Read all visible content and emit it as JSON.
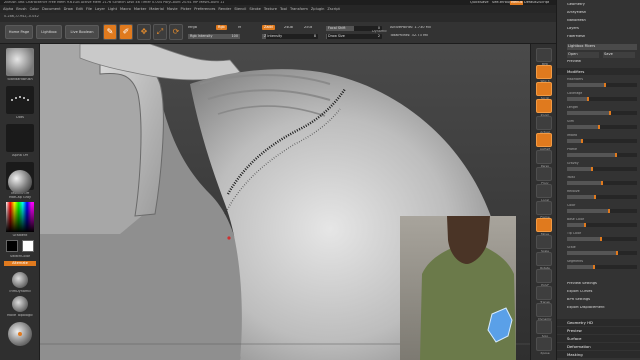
{
  "titlebar": {
    "app": "ZBrush 4R8 P2",
    "items": [
      "ZBrush 4R8",
      "Character09",
      "Free Mem 9.61GB",
      "Active Mem 2176",
      "Scratch Disk 46",
      "Timer 0.004",
      "PolyCount 20.61 MP",
      "MeshCount 11"
    ],
    "quicksave": "QuickSave",
    "seethrough": "See-through 0",
    "menus_btn": "Menus",
    "defaultscript": "DefaultZScript"
  },
  "menubar": [
    "Alpha",
    "Brush",
    "Color",
    "Document",
    "Draw",
    "Edit",
    "File",
    "Layer",
    "Light",
    "Macro",
    "Marker",
    "Material",
    "Movie",
    "Picker",
    "Preferences",
    "Render",
    "Stencil",
    "Stroke",
    "Texture",
    "Tool",
    "Transform",
    "Zplugin",
    "Zscript"
  ],
  "statline": "0.286,-0.942,-0.042",
  "toolbar": {
    "home": "Home Page",
    "lightbox": "Lightbox",
    "livebool": "Live Boolean",
    "icons": [
      {
        "name": "edit-icon",
        "glyph": "✎",
        "label": "Edit"
      },
      {
        "name": "draw-icon",
        "glyph": "✐",
        "label": "Draw"
      },
      {
        "name": "move-icon",
        "glyph": "✥",
        "label": "Move"
      },
      {
        "name": "scale-icon",
        "glyph": "⤢",
        "label": "Scale"
      },
      {
        "name": "rotate-icon",
        "glyph": "⟳",
        "label": "Rotate"
      }
    ],
    "mrgb": "Mrgb",
    "rgb": "Rgb",
    "m": "M",
    "zadd": "Zadd",
    "zsub": "Zsub",
    "zcut": "Zcut",
    "rgb_intensity_label": "Rgb Intensity",
    "rgb_intensity": "100",
    "rgb_intensity_pct": 1.0,
    "z_intensity_label": "Z Intensity",
    "z_intensity": "8",
    "z_intensity_pct": 0.08,
    "focal_label": "Focal Shift",
    "focal": "0",
    "focal_pct": 0.5,
    "draw_size_label": "Draw Size",
    "draw_size": "2",
    "draw_size_pct": 0.02,
    "dynamic": "Dynamic",
    "active_points": "ActivePoints: 1.730 Mil",
    "total_points": "TotalPoints: 32.73 Mil"
  },
  "leftshelf": {
    "brush": "StandardBrush",
    "stroke": "Dots",
    "alpha": "Alpha Off",
    "texture": "Texture Off",
    "material": "MatCap Gray",
    "gradient": "Gradient",
    "switch": "SwitchColor",
    "alternate": "Alternate",
    "draw": "TrimDynamic",
    "move": "Move Topologic",
    "smooth": "Smooth"
  },
  "rightshelf": [
    "BPR",
    "SPix 3",
    "Scroll",
    "Zoom",
    "Actual",
    "AAHalf",
    "Persp",
    "Floor",
    "Local",
    "Frame",
    "Move",
    "Scale",
    "Rotate",
    "PolyF",
    "Transp",
    "Dynamic",
    "Solo",
    "Xpose"
  ],
  "tray": {
    "items": [
      "Geometry",
      "ArrayMesh",
      "NanoMesh",
      "Layers",
      "FiberMesh",
      "Lightbox Fibers",
      "Open",
      "Save",
      "Preview",
      "Modifiers",
      "Preview Settings",
      "Export Curves",
      "BPR Settings",
      "Export Displacement",
      "Geometry HD",
      "Preview",
      "Surface",
      "Deformation",
      "Masking"
    ],
    "fiber_labels": [
      "MaxFibers",
      "Coverage",
      "Length",
      "Slim",
      "Imbed",
      "Profile",
      "Gravity",
      "Twist",
      "Revolve",
      "Color",
      "Base Color",
      "Tip Color",
      "Scale",
      "Segments"
    ],
    "fiber_values": [
      0.55,
      0.3,
      0.62,
      0.45,
      0.2,
      0.7,
      0.35,
      0.5,
      0.4,
      0.6,
      0.25,
      0.48,
      0.72,
      0.38
    ],
    "accent": "#e07a1e"
  },
  "colors": {
    "accent": "#e07a1e",
    "bg": "#2b2b2b",
    "panel": "#333333"
  }
}
